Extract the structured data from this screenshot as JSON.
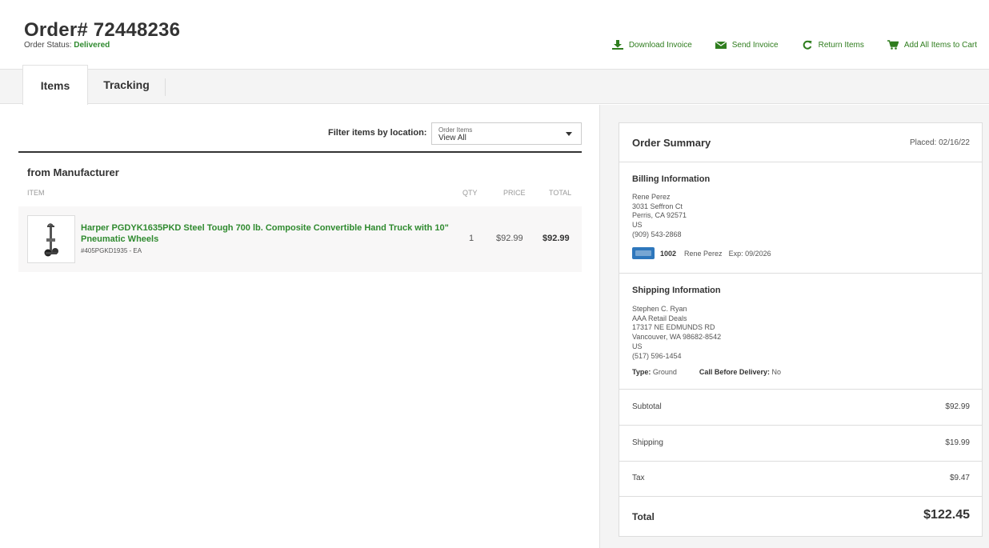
{
  "header": {
    "title": "Order# 72448236",
    "status_label": "Order Status:",
    "status_value": "Delivered"
  },
  "actions": [
    {
      "label": "Download Invoice",
      "icon": "download-icon"
    },
    {
      "label": "Send Invoice",
      "icon": "envelope-icon"
    },
    {
      "label": "Return Items",
      "icon": "refresh-icon"
    },
    {
      "label": "Add All Items to Cart",
      "icon": "cart-icon"
    }
  ],
  "tabs": [
    {
      "label": "Items",
      "active": true
    },
    {
      "label": "Tracking",
      "active": false
    }
  ],
  "filter": {
    "label": "Filter items by location:",
    "select_caption": "Order Items",
    "select_value": "View All"
  },
  "group": {
    "title": "from Manufacturer",
    "columns": {
      "item": "ITEM",
      "qty": "QTY",
      "price": "PRICE",
      "total": "TOTAL"
    }
  },
  "items": [
    {
      "name": "Harper PGDYK1635PKD Steel Tough 700 lb. Composite Convertible Hand Truck with 10\" Pneumatic Wheels",
      "sku": "#405PGKD1935 - EA",
      "qty": "1",
      "price": "$92.99",
      "total": "$92.99"
    }
  ],
  "summary": {
    "title": "Order Summary",
    "placed": "Placed: 02/16/22",
    "billing": {
      "title": "Billing Information",
      "lines": [
        "Rene Perez",
        "3031 Seffron Ct",
        "Perris, CA 92571",
        "US",
        "(909) 543-2868"
      ],
      "card_last4": "1002",
      "card_name": "Rene Perez",
      "card_exp": "Exp: 09/2026"
    },
    "shipping": {
      "title": "Shipping Information",
      "lines": [
        "Stephen C. Ryan",
        "AAA Retail Deals",
        "17317 NE EDMUNDS RD",
        "Vancouver, WA 98682-8542",
        "US",
        "(517) 596-1454"
      ],
      "type_label": "Type:",
      "type_value": "Ground",
      "call_label": "Call Before Delivery:",
      "call_value": "No"
    },
    "subtotal_label": "Subtotal",
    "subtotal": "$92.99",
    "shipping_label": "Shipping",
    "shipping_cost": "$19.99",
    "tax_label": "Tax",
    "tax": "$9.47",
    "total_label": "Total",
    "total": "$122.45"
  },
  "colors": {
    "accent_green": "#2f8a2f",
    "amex_blue": "#2e77bc"
  }
}
